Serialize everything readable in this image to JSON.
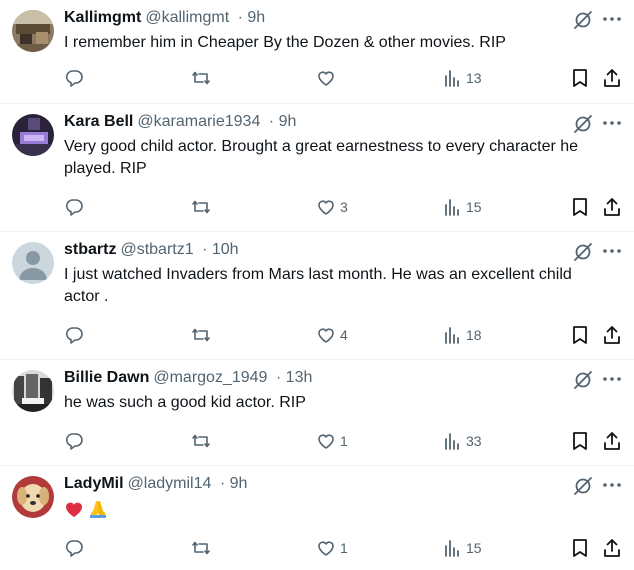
{
  "tweets": [
    {
      "name": "Kallimgmt",
      "handle": "@kallimgmt",
      "time": "· 9h",
      "text": "I remember him in Cheaper By the Dozen & other movies. RIP",
      "likes": "",
      "views": "13",
      "avatar": "room-photo"
    },
    {
      "name": "Kara Bell",
      "handle": "@karamarie1934",
      "time": "· 9h",
      "text": "Very good child actor. Brought a great earnestness to every character he played. RIP",
      "likes": "3",
      "views": "15",
      "avatar": "purple-lamp-photo"
    },
    {
      "name": "stbartz",
      "handle": "@stbartz1",
      "time": "· 10h",
      "text": "I just watched Invaders from Mars last month. He was an excellent child actor .",
      "likes": "4",
      "views": "18",
      "avatar": "default-user"
    },
    {
      "name": "Billie Dawn",
      "handle": "@margoz_1949",
      "time": "· 13h",
      "text": "he was such a good kid actor. RIP",
      "likes": "1",
      "views": "33",
      "avatar": "black-white-photo"
    },
    {
      "name": "LadyMil",
      "handle": "@ladymil14",
      "time": "· 9h",
      "text": "",
      "likes": "1",
      "views": "15",
      "avatar": "puppy-photo",
      "emojis": [
        "red-heart",
        "folded-hands"
      ]
    }
  ],
  "icons": {
    "reply": "reply-icon",
    "retweet": "retweet-icon",
    "like": "like-icon",
    "views": "views-icon",
    "bookmark": "bookmark-icon",
    "share": "share-icon",
    "grok": "grok-icon",
    "more": "more-icon"
  },
  "colors": {
    "text": "#0f1419",
    "secondary": "#536471",
    "divider": "#eff3f4"
  }
}
